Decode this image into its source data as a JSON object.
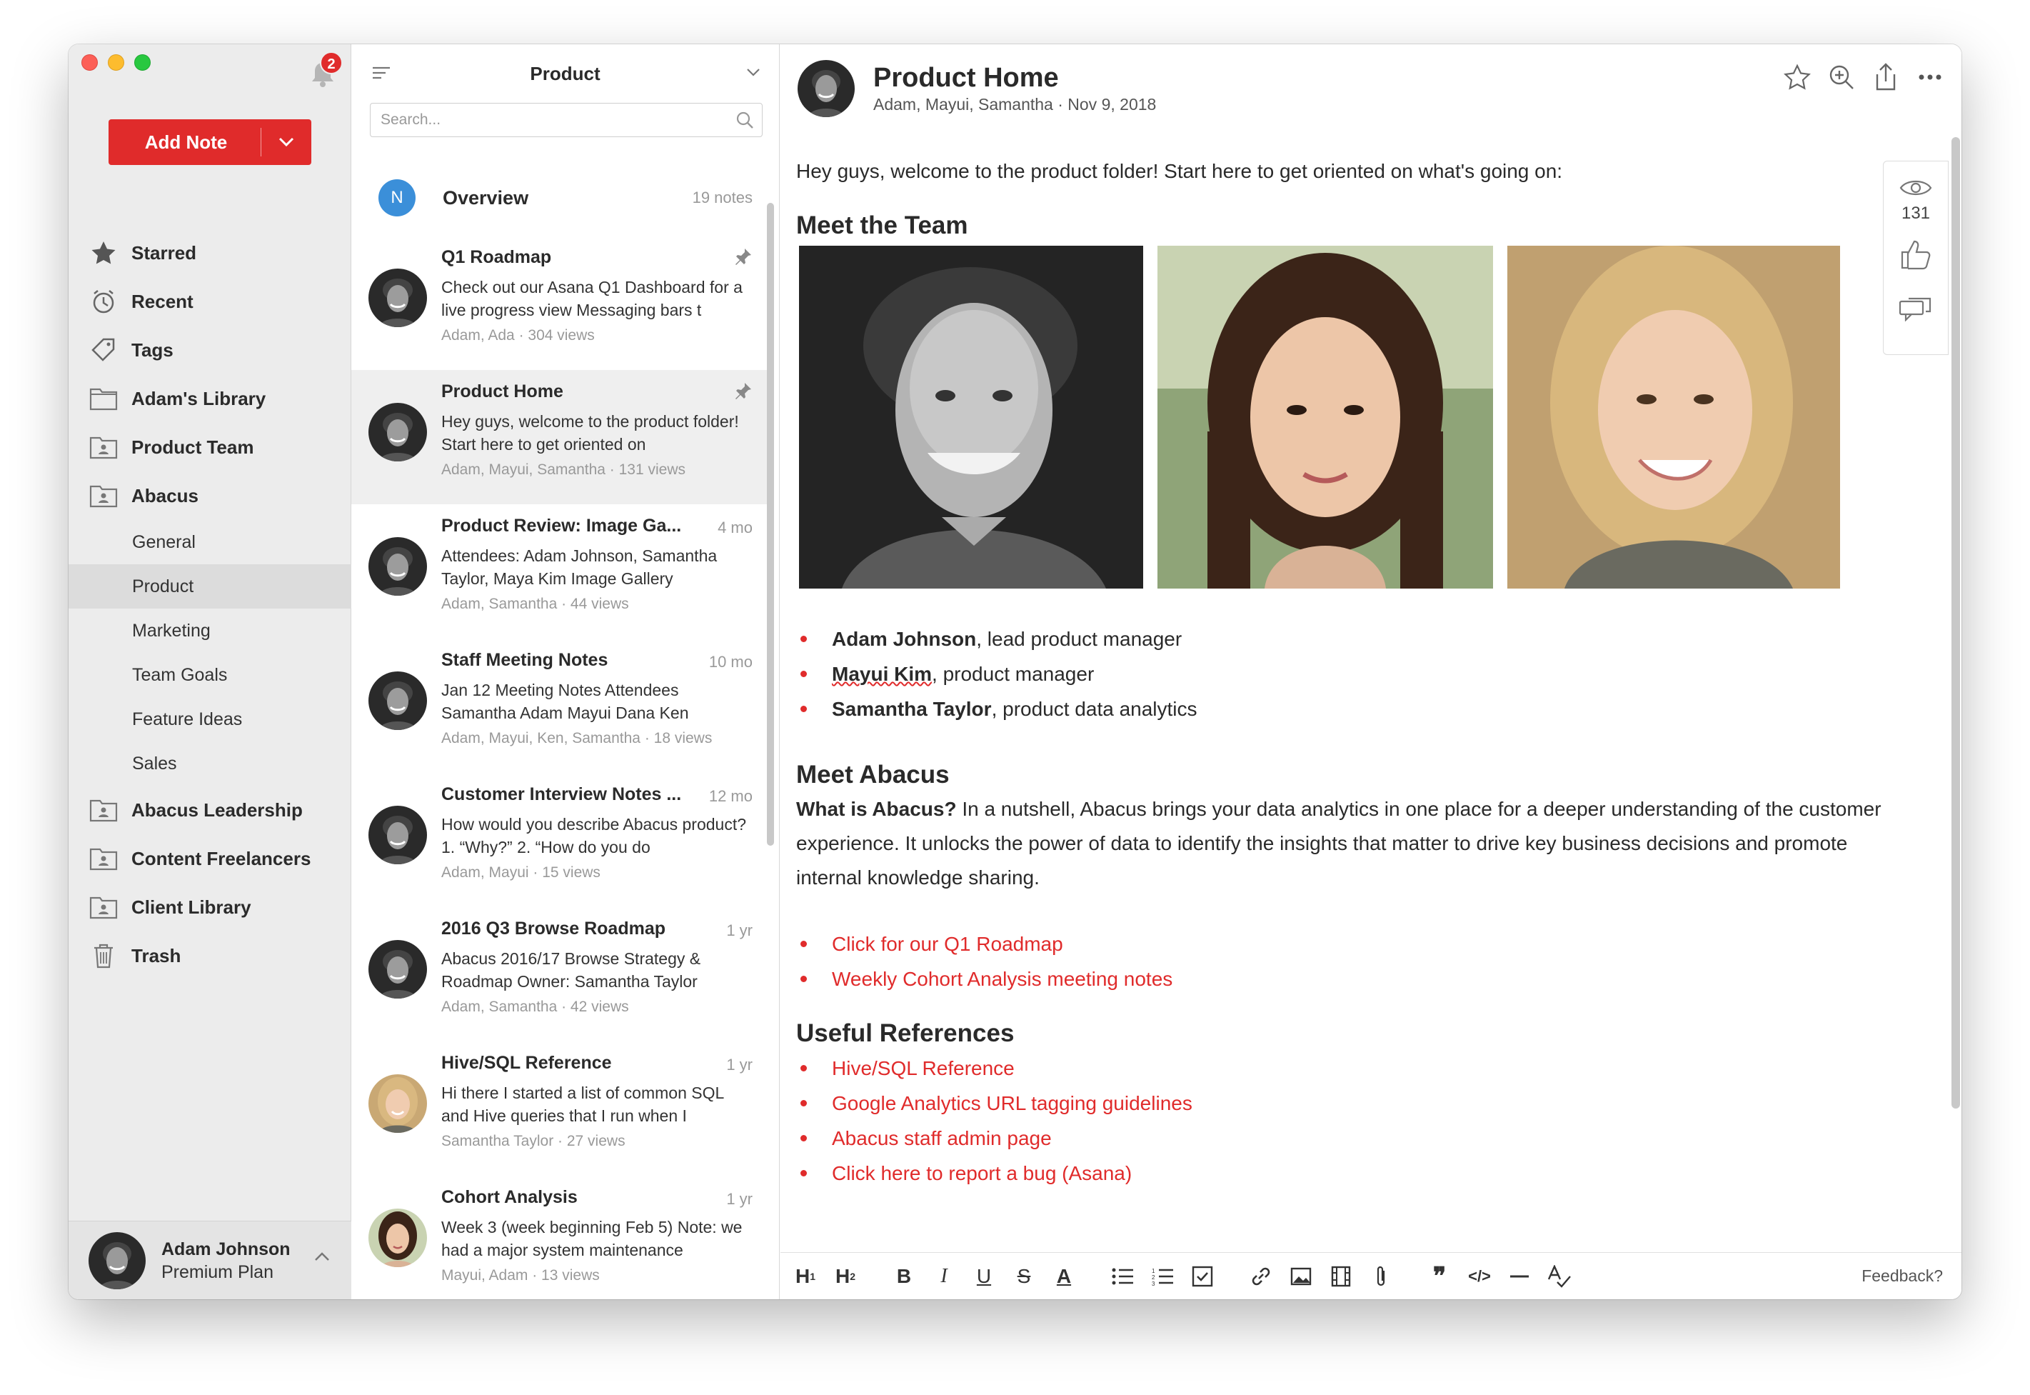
{
  "notifications": {
    "count": "2"
  },
  "sidebar": {
    "add_note_label": "Add Note",
    "items": [
      {
        "label": "Starred",
        "icon": "star-icon"
      },
      {
        "label": "Recent",
        "icon": "clock-icon"
      },
      {
        "label": "Tags",
        "icon": "tag-icon"
      },
      {
        "label": "Adam's Library",
        "icon": "folder-icon"
      },
      {
        "label": "Product Team",
        "icon": "shared-folder-icon"
      },
      {
        "label": "Abacus",
        "icon": "shared-folder-icon"
      }
    ],
    "subitems": [
      "General",
      "Product",
      "Marketing",
      "Team Goals",
      "Feature Ideas",
      "Sales"
    ],
    "items_after": [
      {
        "label": "Abacus Leadership",
        "icon": "shared-folder-icon"
      },
      {
        "label": "Content Freelancers",
        "icon": "shared-folder-icon"
      },
      {
        "label": "Client Library",
        "icon": "shared-folder-icon"
      },
      {
        "label": "Trash",
        "icon": "trash-icon"
      }
    ],
    "user": {
      "name": "Adam Johnson",
      "plan": "Premium Plan"
    }
  },
  "list": {
    "title": "Product",
    "search_placeholder": "Search...",
    "overview": {
      "badge": "N",
      "title": "Overview",
      "count": "19 notes"
    },
    "notes": [
      {
        "title": "Q1 Roadmap",
        "time": "",
        "pinned": true,
        "body": "Check out our Asana Q1 Dashboard for a live progress view Messaging bars t",
        "meta": "Adam, Ada · 304 views",
        "avatar": "man"
      },
      {
        "title": "Product Home",
        "time": "",
        "pinned": true,
        "body": "Hey guys, welcome to the product folder! Start here to get oriented on",
        "meta": "Adam, Mayui, Samantha · 131 views",
        "avatar": "man"
      },
      {
        "title": "Product Review: Image Ga...",
        "time": "4 mo",
        "pinned": false,
        "body": "Attendees: Adam Johnson, Samantha Taylor, Maya Kim Image Gallery",
        "meta": "Adam, Samantha · 44 views",
        "avatar": "man"
      },
      {
        "title": "Staff Meeting Notes",
        "time": "10 mo",
        "pinned": false,
        "body": "Jan 12 Meeting Notes Attendees Samantha Adam Mayui Dana Ken",
        "meta": "Adam, Mayui, Ken, Samantha · 18 views",
        "avatar": "man"
      },
      {
        "title": "Customer Interview Notes ...",
        "time": "12 mo",
        "pinned": false,
        "body": "How would you describe Abacus product? 1. “Why?” 2. “How do you do",
        "meta": "Adam, Mayui · 15 views",
        "avatar": "man"
      },
      {
        "title": "2016 Q3 Browse Roadmap",
        "time": "1 yr",
        "pinned": false,
        "body": "Abacus 2016/17 Browse Strategy & Roadmap Owner: Samantha Taylor",
        "meta": "Adam, Samantha · 42 views",
        "avatar": "man"
      },
      {
        "title": "Hive/SQL Reference",
        "time": "1 yr",
        "pinned": false,
        "body": "Hi there I started a list of common SQL and Hive queries that I run when I",
        "meta": "Samantha Taylor · 27 views",
        "avatar": "blonde"
      },
      {
        "title": "Cohort Analysis",
        "time": "1 yr",
        "pinned": false,
        "body": "Week 3 (week beginning Feb 5) Note: we had a major system maintenance",
        "meta": "Mayui, Adam · 13 views",
        "avatar": "asian"
      }
    ]
  },
  "doc": {
    "title": "Product Home",
    "meta": "Adam, Mayui, Samantha · Nov 9, 2018",
    "intro": "Hey guys, welcome to the product folder! Start here to get oriented on what's going on:",
    "team_heading": "Meet the Team",
    "team": [
      {
        "name": "Adam Johnson",
        "role": ", lead product manager"
      },
      {
        "name": "Mayui Kim",
        "role": ", product manager"
      },
      {
        "name": "Samantha Taylor",
        "role": ", product data analytics"
      }
    ],
    "abacus_heading": "Meet Abacus",
    "abacus_lead": "What is Abacus?",
    "abacus_text": " In a nutshell, Abacus brings your data analytics in one place for a deeper understanding of the customer experience. It unlocks the power of data to identify the insights that matter to drive key business decisions and promote internal knowledge sharing.",
    "abacus_links": [
      "Click for our Q1 Roadmap",
      "Weekly Cohort Analysis meeting notes"
    ],
    "refs_heading": "Useful References",
    "refs_links": [
      "Hive/SQL Reference",
      "Google Analytics URL tagging guidelines",
      "Abacus staff admin page",
      "Click here to report a bug (Asana)"
    ],
    "views": "131"
  },
  "toolbar": {
    "feedback": "Feedback?"
  },
  "colors": {
    "accent": "#e02b2b",
    "overview_badge": "#3b8fd9"
  }
}
